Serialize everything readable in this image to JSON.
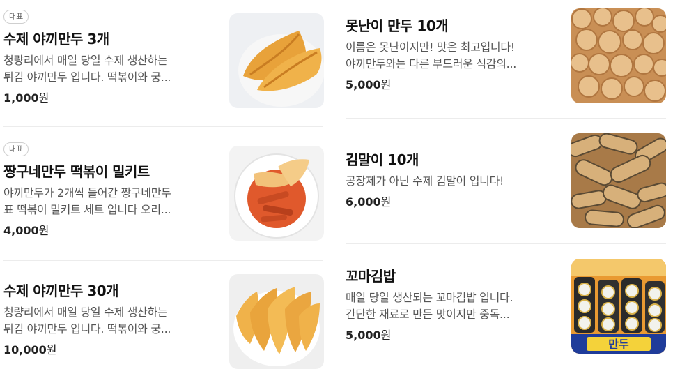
{
  "menu": {
    "left": [
      {
        "badge": "대표",
        "name": "수제 야끼만두 3개",
        "desc_lines": [
          "청량리에서 매일 당일 수제 생산하는",
          "튀김 야끼만두 입니다. 떡볶이와 궁..."
        ],
        "price": "1,000",
        "won": "원"
      },
      {
        "badge": "대표",
        "name": "짱구네만두 떡볶이 밀키트",
        "desc_lines": [
          "야끼만두가 2개씩 들어간 짱구네만두",
          "표 떡볶이 밀키트 세트 입니다 오리..."
        ],
        "price": "4,000",
        "won": "원"
      },
      {
        "name": "수제 야끼만두 30개",
        "desc_lines": [
          "청량리에서 매일 당일 수제 생산하는",
          "튀김 야끼만두 입니다. 떡볶이와 궁..."
        ],
        "price": "10,000",
        "won": "원"
      }
    ],
    "right": [
      {
        "name": "못난이 만두 10개",
        "desc_lines": [
          "이름은 못난이지만! 맛은 최고입니다!",
          "야끼만두와는 다른 부드러운 식감의..."
        ],
        "price": "5,000",
        "won": "원"
      },
      {
        "name": "김말이 10개",
        "desc_lines": [
          "공장제가 아닌 수제 김말이 입니다!"
        ],
        "price": "6,000",
        "won": "원"
      },
      {
        "name": "꼬마김밥",
        "desc_lines": [
          "매일 당일 생산되는 꼬마김밥 입니다.",
          "간단한 재료로 만든 맛이지만 중독..."
        ],
        "price": "5,000",
        "won": "원"
      }
    ],
    "sign_text": "만두"
  }
}
